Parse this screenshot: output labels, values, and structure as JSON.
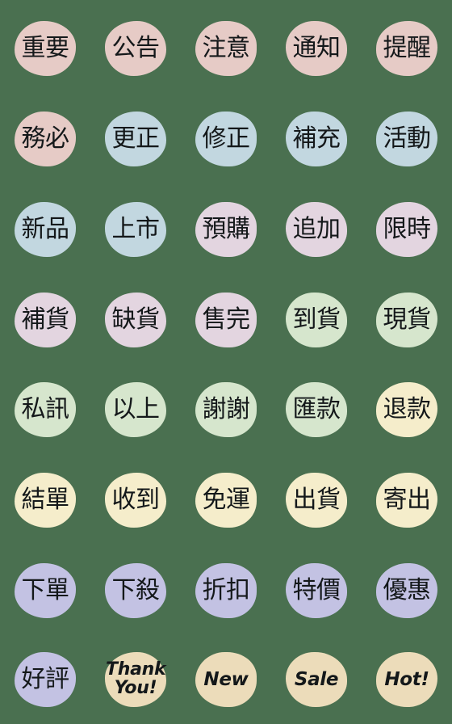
{
  "sheet": {
    "background_color": "#4a7050",
    "text_color": "#14181a",
    "columns": 5,
    "rows": 8,
    "total_stickers": 40,
    "title": "Chinese e-commerce label emoji sticker sheet"
  },
  "palette": {
    "dusty_pink": "#e6cbc6",
    "light_blue": "#c2d7e0",
    "pale_mauve": "#e3d5e0",
    "sage_green": "#d6e6cd",
    "cream_yellow": "#f5edcb",
    "periwinkle": "#c3c2e3",
    "tan_beige": "#ecdcba"
  },
  "stickers": [
    {
      "text": "重要",
      "color": "#e6cbc6",
      "script": "han",
      "row": 1,
      "col": 1
    },
    {
      "text": "公告",
      "color": "#e6cbc6",
      "script": "han",
      "row": 1,
      "col": 2
    },
    {
      "text": "注意",
      "color": "#e6cbc6",
      "script": "han",
      "row": 1,
      "col": 3
    },
    {
      "text": "通知",
      "color": "#e6cbc6",
      "script": "han",
      "row": 1,
      "col": 4
    },
    {
      "text": "提醒",
      "color": "#e6cbc6",
      "script": "han",
      "row": 1,
      "col": 5
    },
    {
      "text": "務必",
      "color": "#e6cbc6",
      "script": "han",
      "row": 2,
      "col": 1
    },
    {
      "text": "更正",
      "color": "#c2d7e0",
      "script": "han",
      "row": 2,
      "col": 2
    },
    {
      "text": "修正",
      "color": "#c2d7e0",
      "script": "han",
      "row": 2,
      "col": 3
    },
    {
      "text": "補充",
      "color": "#c2d7e0",
      "script": "han",
      "row": 2,
      "col": 4
    },
    {
      "text": "活動",
      "color": "#c2d7e0",
      "script": "han",
      "row": 2,
      "col": 5
    },
    {
      "text": "新品",
      "color": "#c2d7e0",
      "script": "han",
      "row": 3,
      "col": 1
    },
    {
      "text": "上市",
      "color": "#c2d7e0",
      "script": "han",
      "row": 3,
      "col": 2
    },
    {
      "text": "預購",
      "color": "#e3d5e0",
      "script": "han",
      "row": 3,
      "col": 3
    },
    {
      "text": "追加",
      "color": "#e3d5e0",
      "script": "han",
      "row": 3,
      "col": 4
    },
    {
      "text": "限時",
      "color": "#e3d5e0",
      "script": "han",
      "row": 3,
      "col": 5
    },
    {
      "text": "補貨",
      "color": "#e3d5e0",
      "script": "han",
      "row": 4,
      "col": 1
    },
    {
      "text": "缺貨",
      "color": "#e3d5e0",
      "script": "han",
      "row": 4,
      "col": 2
    },
    {
      "text": "售完",
      "color": "#e3d5e0",
      "script": "han",
      "row": 4,
      "col": 3
    },
    {
      "text": "到貨",
      "color": "#d6e6cd",
      "script": "han",
      "row": 4,
      "col": 4
    },
    {
      "text": "現貨",
      "color": "#d6e6cd",
      "script": "han",
      "row": 4,
      "col": 5
    },
    {
      "text": "私訊",
      "color": "#d6e6cd",
      "script": "han",
      "row": 5,
      "col": 1
    },
    {
      "text": "以上",
      "color": "#d6e6cd",
      "script": "han",
      "row": 5,
      "col": 2
    },
    {
      "text": "謝謝",
      "color": "#d6e6cd",
      "script": "han",
      "row": 5,
      "col": 3
    },
    {
      "text": "匯款",
      "color": "#d6e6cd",
      "script": "han",
      "row": 5,
      "col": 4
    },
    {
      "text": "退款",
      "color": "#f5edcb",
      "script": "han",
      "row": 5,
      "col": 5
    },
    {
      "text": "結單",
      "color": "#f5edcb",
      "script": "han",
      "row": 6,
      "col": 1
    },
    {
      "text": "收到",
      "color": "#f5edcb",
      "script": "han",
      "row": 6,
      "col": 2
    },
    {
      "text": "免運",
      "color": "#f5edcb",
      "script": "han",
      "row": 6,
      "col": 3
    },
    {
      "text": "出貨",
      "color": "#f5edcb",
      "script": "han",
      "row": 6,
      "col": 4
    },
    {
      "text": "寄出",
      "color": "#f5edcb",
      "script": "han",
      "row": 6,
      "col": 5
    },
    {
      "text": "下單",
      "color": "#c3c2e3",
      "script": "han",
      "row": 7,
      "col": 1
    },
    {
      "text": "下殺",
      "color": "#c3c2e3",
      "script": "han",
      "row": 7,
      "col": 2
    },
    {
      "text": "折扣",
      "color": "#c3c2e3",
      "script": "han",
      "row": 7,
      "col": 3
    },
    {
      "text": "特價",
      "color": "#c3c2e3",
      "script": "han",
      "row": 7,
      "col": 4
    },
    {
      "text": "優惠",
      "color": "#c3c2e3",
      "script": "han",
      "row": 7,
      "col": 5
    },
    {
      "text": "好評",
      "color": "#c3c2e3",
      "script": "han",
      "row": 8,
      "col": 1
    },
    {
      "text": "Thank You!",
      "color": "#ecdcba",
      "script": "latin",
      "lines": 2,
      "row": 8,
      "col": 2
    },
    {
      "text": "New",
      "color": "#ecdcba",
      "script": "latin",
      "row": 8,
      "col": 3
    },
    {
      "text": "Sale",
      "color": "#ecdcba",
      "script": "latin",
      "row": 8,
      "col": 4
    },
    {
      "text": "Hot!",
      "color": "#ecdcba",
      "script": "latin",
      "row": 8,
      "col": 5
    }
  ]
}
